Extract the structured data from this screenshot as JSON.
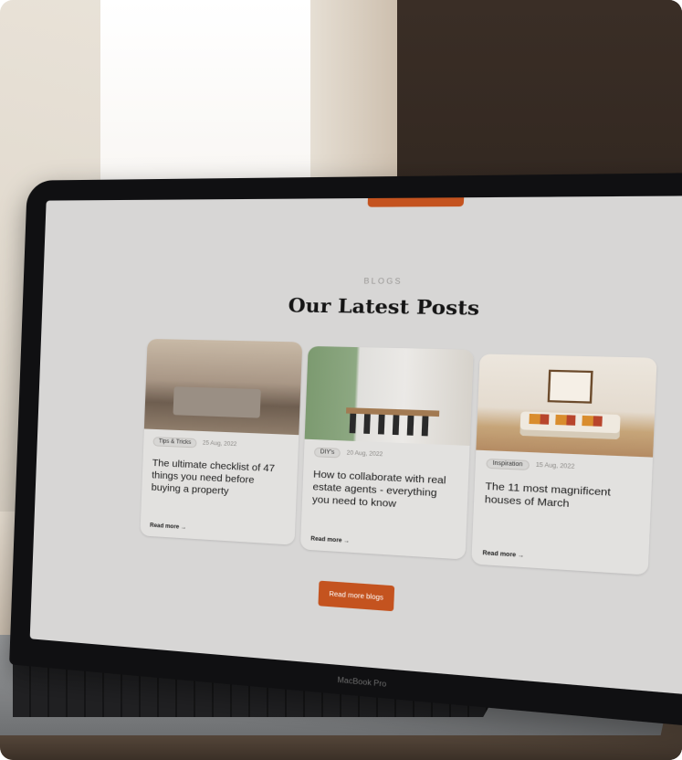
{
  "scene": {
    "device_brand": "MacBook Pro"
  },
  "screen": {
    "section_label": "BLOGS",
    "heading": "Our Latest Posts",
    "cta_label": "Read more blogs"
  },
  "posts": [
    {
      "tag": "Tips & Tricks",
      "date": "25 Aug, 2022",
      "title": "The ultimate checklist of 47 things you need before buying a property",
      "read_more": "Read more →"
    },
    {
      "tag": "DIY's",
      "date": "20 Aug, 2022",
      "title": "How to collaborate with real estate agents - everything you need to know",
      "read_more": "Read more →"
    },
    {
      "tag": "Inspiration",
      "date": "15 Aug, 2022",
      "title": "The 11 most magnificent houses of March",
      "read_more": "Read more →"
    }
  ],
  "colors": {
    "accent": "#c4531f",
    "screen_bg": "#d7d6d5",
    "card_bg": "#e2e1df",
    "text": "#151515"
  }
}
